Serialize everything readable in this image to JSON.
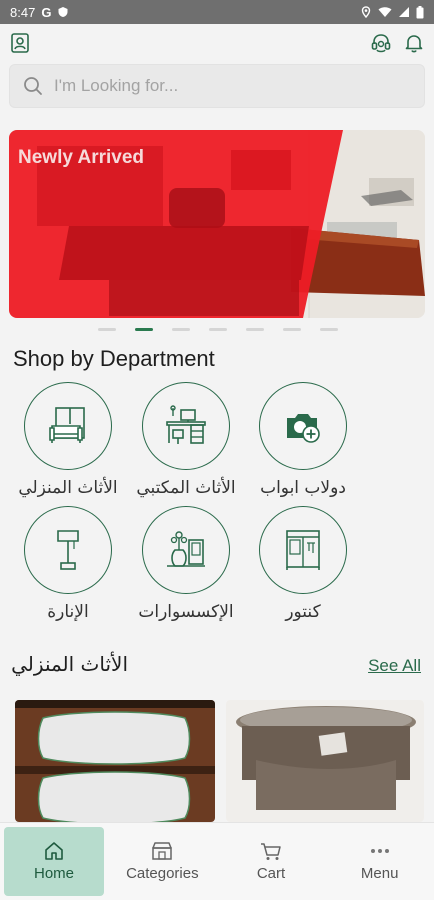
{
  "status_bar": {
    "time": "8:47",
    "carrier_glyph": "G"
  },
  "colors": {
    "brand_green": "#2a6a4b",
    "banner_red": "#ee1c25",
    "active_tab_bg": "#b7dccd"
  },
  "search": {
    "placeholder": "I'm Looking for..."
  },
  "banner": {
    "title": "Newly Arrived",
    "slide_count": 7,
    "active_slide": 2
  },
  "shop_by_department": {
    "title": "Shop by Department",
    "items": [
      {
        "label": "الأثاث المنزلي",
        "icon": "sofa-wardrobe-icon"
      },
      {
        "label": "الأثاث المكتبي",
        "icon": "office-desk-icon"
      },
      {
        "label": "دولاب ابواب",
        "icon": "add-photo-icon"
      },
      {
        "label": "الإنارة",
        "icon": "lamp-icon"
      },
      {
        "label": "الإكسسوارات",
        "icon": "vase-frame-icon"
      },
      {
        "label": "كنتور",
        "icon": "cabinet-icon"
      }
    ]
  },
  "home_furniture": {
    "title": "الأثاث المنزلي",
    "see_all": "See All"
  },
  "bottom_nav": [
    {
      "label": "Home",
      "icon": "home-icon",
      "active": true
    },
    {
      "label": "Categories",
      "icon": "categories-icon",
      "active": false
    },
    {
      "label": "Cart",
      "icon": "cart-icon",
      "active": false
    },
    {
      "label": "Menu",
      "icon": "menu-dots-icon",
      "active": false
    }
  ]
}
